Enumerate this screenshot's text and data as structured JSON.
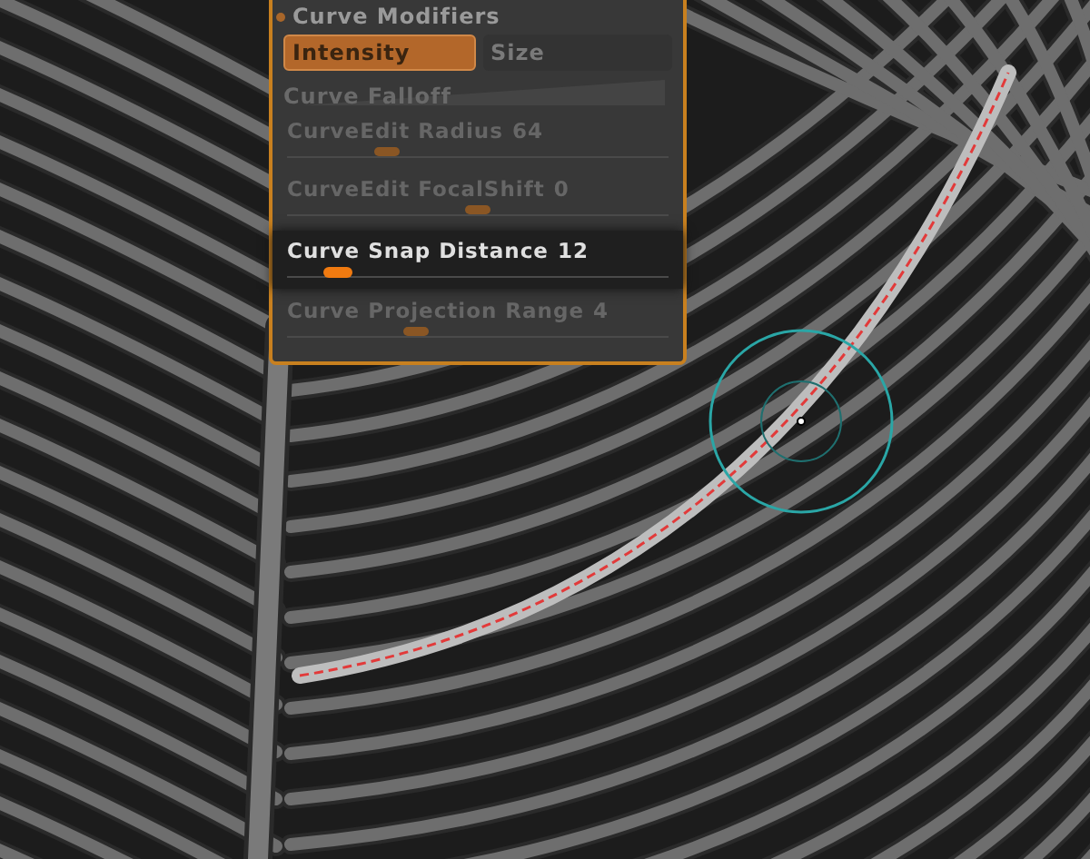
{
  "panel": {
    "title": "Curve Modifiers",
    "mode_buttons": [
      {
        "label": "Intensity",
        "selected": true
      },
      {
        "label": "Size",
        "selected": false
      }
    ],
    "falloff": {
      "label": "Curve Falloff"
    },
    "sliders": [
      {
        "label": "CurveEdit Radius",
        "value": "64",
        "level": 0.26,
        "selected": false
      },
      {
        "label": "CurveEdit FocalShift",
        "value": "0",
        "level": 0.5,
        "selected": false
      },
      {
        "label": "Curve Snap Distance",
        "value": "12",
        "level": 0.13,
        "selected": true
      },
      {
        "label": "Curve Projection Range",
        "value": "4",
        "level": 0.34,
        "selected": false
      }
    ]
  }
}
